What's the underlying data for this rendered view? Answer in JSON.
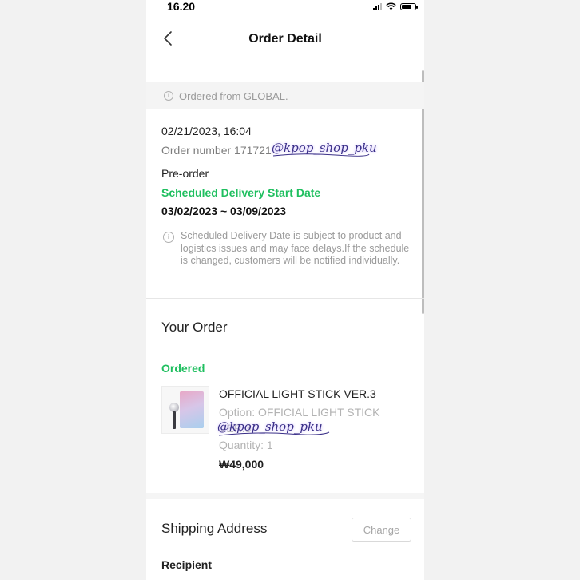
{
  "status_bar": {
    "time": "16.20"
  },
  "header": {
    "title": "Order Detail",
    "back_icon": "chevron-left-icon"
  },
  "notice": {
    "text": "Ordered from GLOBAL.",
    "icon": "info-icon"
  },
  "order": {
    "datetime": "02/21/2023, 16:04",
    "number_label": "Order number 171721",
    "type": "Pre-order",
    "schedule_label": "Scheduled Delivery Start Date",
    "schedule_range": "03/02/2023 ~ 03/09/2023",
    "disclaimer": "Scheduled Delivery Date is subject to product and logistics issues and may face delays.If the schedule is changed, customers will be notified individually."
  },
  "watermark": {
    "text": "@kpop_shop_pku"
  },
  "your_order": {
    "title": "Your Order",
    "status": "Ordered",
    "item": {
      "name": "OFFICIAL LIGHT STICK VER.3",
      "option": "Option: OFFICIAL LIGHT STICK VER.3",
      "quantity": "Quantity: 1",
      "price": "₩49,000"
    }
  },
  "shipping": {
    "title": "Shipping Address",
    "change_label": "Change",
    "recipient_label": "Recipient"
  },
  "colors": {
    "accent_green": "#1fbf5f",
    "muted_text": "#9a9a9a"
  }
}
